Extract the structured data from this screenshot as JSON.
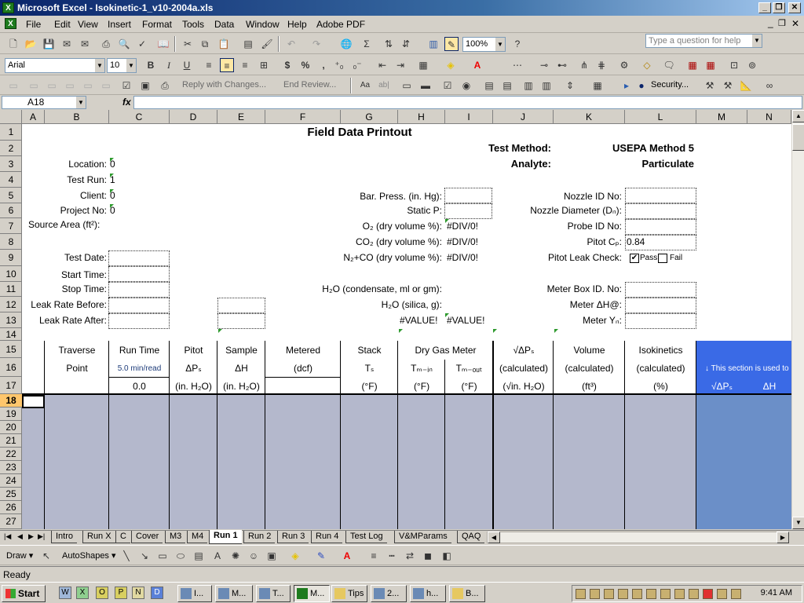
{
  "window": {
    "title": "Microsoft Excel - Isokinetic-1_v10-2004a.xls",
    "minimize": "_",
    "restore": "❐",
    "close": "✕",
    "doc_minimize": "_",
    "doc_restore": "❐",
    "doc_close": "✕"
  },
  "menu": [
    "File",
    "Edit",
    "View",
    "Insert",
    "Format",
    "Tools",
    "Data",
    "Window",
    "Help",
    "Adobe PDF"
  ],
  "help_placeholder": "Type a question for help",
  "toolbar": {
    "zoom": "100%",
    "font": "Arial",
    "font_size": "10",
    "bold": "B",
    "italic": "I",
    "underline": "U",
    "currency": "$",
    "percent": "%",
    "comma": ",",
    "autosum": "Σ",
    "reply_label": "Reply with Changes...",
    "end_review_label": "End Review...",
    "security_label": "Security...",
    "text_tool": "Aa",
    "text_tool2": "ab|"
  },
  "formula": {
    "name_box": "A18",
    "fx": "fx",
    "value": ""
  },
  "columns": [
    "A",
    "B",
    "C",
    "D",
    "E",
    "F",
    "G",
    "H",
    "I",
    "J",
    "K",
    "L",
    "M",
    "N"
  ],
  "rows": [
    "1",
    "2",
    "3",
    "4",
    "5",
    "6",
    "7",
    "8",
    "9",
    "10",
    "11",
    "12",
    "13",
    "14",
    "15",
    "16",
    "17",
    "18",
    "19",
    "20",
    "21",
    "22",
    "23",
    "24",
    "25",
    "26",
    "27"
  ],
  "sheet": {
    "title": "Field Data Printout",
    "test_method_label": "Test Method:",
    "test_method_value": "USEPA Method 5",
    "analyte_label": "Analyte:",
    "analyte_value": "Particulate",
    "location_label": "Location:",
    "location_value": "0",
    "test_run_label": "Test Run:",
    "test_run_value": "1",
    "client_label": "Client:",
    "client_value": "0",
    "project_label": "Project No:",
    "project_value": "0",
    "source_area_label": "Source Area (ft²):",
    "bar_press_label": "Bar. Press. (in. Hg):",
    "static_p_label": "Static P:",
    "o2_label": "O₂ (dry volume %):",
    "o2_value": "#DIV/0!",
    "co2_label": "CO₂ (dry volume %):",
    "co2_value": "#DIV/0!",
    "n2co_label": "N₂+CO (dry volume %):",
    "n2co_value": "#DIV/0!",
    "nozzle_id_label": "Nozzle ID No:",
    "nozzle_diam_label": "Nozzle Diameter (Dₙ):",
    "probe_id_label": "Probe ID No:",
    "pitot_cp_label": "Pitot Cₚ:",
    "pitot_cp_value": "0.84",
    "pitot_leak_label": "Pitot Leak Check:",
    "pass_label": "Pass",
    "fail_label": "Fail",
    "pass_mark": "✔",
    "test_date_label": "Test Date:",
    "start_time_label": "Start Time:",
    "stop_time_label": "Stop Time:",
    "leak_before_label": "Leak Rate Before:",
    "leak_after_label": "Leak Rate After:",
    "h2o_cond_label": "H₂O (condensate, ml or gm):",
    "h2o_silica_label": "H₂O (silica, g):",
    "value_err_1": "#VALUE!",
    "value_err_2": "#VALUE!",
    "meter_box_label": "Meter Box ID. No:",
    "meter_dh_label": "Meter ΔH@:",
    "meter_yd_label": "Meter Yₙ:",
    "hdr": {
      "traverse": "Traverse",
      "point": "Point",
      "run_time": "Run Time",
      "run_rate": "5.0 min/read",
      "run_start": "0.0",
      "pitot": "Pitot",
      "pitot_sym": "ΔPₛ",
      "pitot_unit": "(in. H₂O)",
      "sample": "Sample",
      "sample_sym": "ΔH",
      "sample_unit": "(in. H₂O)",
      "metered": "Metered",
      "metered_unit": "(dcf)",
      "stack": "Stack",
      "stack_sym": "Tₛ",
      "stack_unit": "(°F)",
      "dgm": "Dry Gas Meter",
      "tmin": "Tₘ₋ᵢₙ",
      "tmout": "Tₘ₋ₒᵤₜ",
      "dgm_unit1": "(°F)",
      "dgm_unit2": "(°F)",
      "sqrt": "√ΔPₛ",
      "sqrt_calc": "(calculated)",
      "sqrt_unit": "(√in. H₂O)",
      "volume": "Volume",
      "vol_calc": "(calculated)",
      "vol_unit": "(ft³)",
      "iso": "Isokinetics",
      "iso_calc": "(calculated)",
      "iso_unit": "(%)",
      "section_note": "↓ This section is used to",
      "m_sqrt": "√ΔPₛ",
      "m_dh": "ΔH"
    }
  },
  "tabs": [
    "Intro",
    "Run X",
    "C",
    "Cover",
    "M3",
    "M4",
    "Run 1",
    "Run 2",
    "Run 3",
    "Run 4",
    "Test Log",
    "V&MParams",
    "QAQ"
  ],
  "active_tab": "Run 1",
  "draw": {
    "draw_label": "Draw ▾",
    "autoshapes_label": "AutoShapes ▾"
  },
  "status": "Ready",
  "taskbar": {
    "start": "Start",
    "items": [
      "I...",
      "M...",
      "T...",
      "M...",
      "Tips",
      "2...",
      "h...",
      "B..."
    ],
    "clock": "9:41 AM"
  }
}
